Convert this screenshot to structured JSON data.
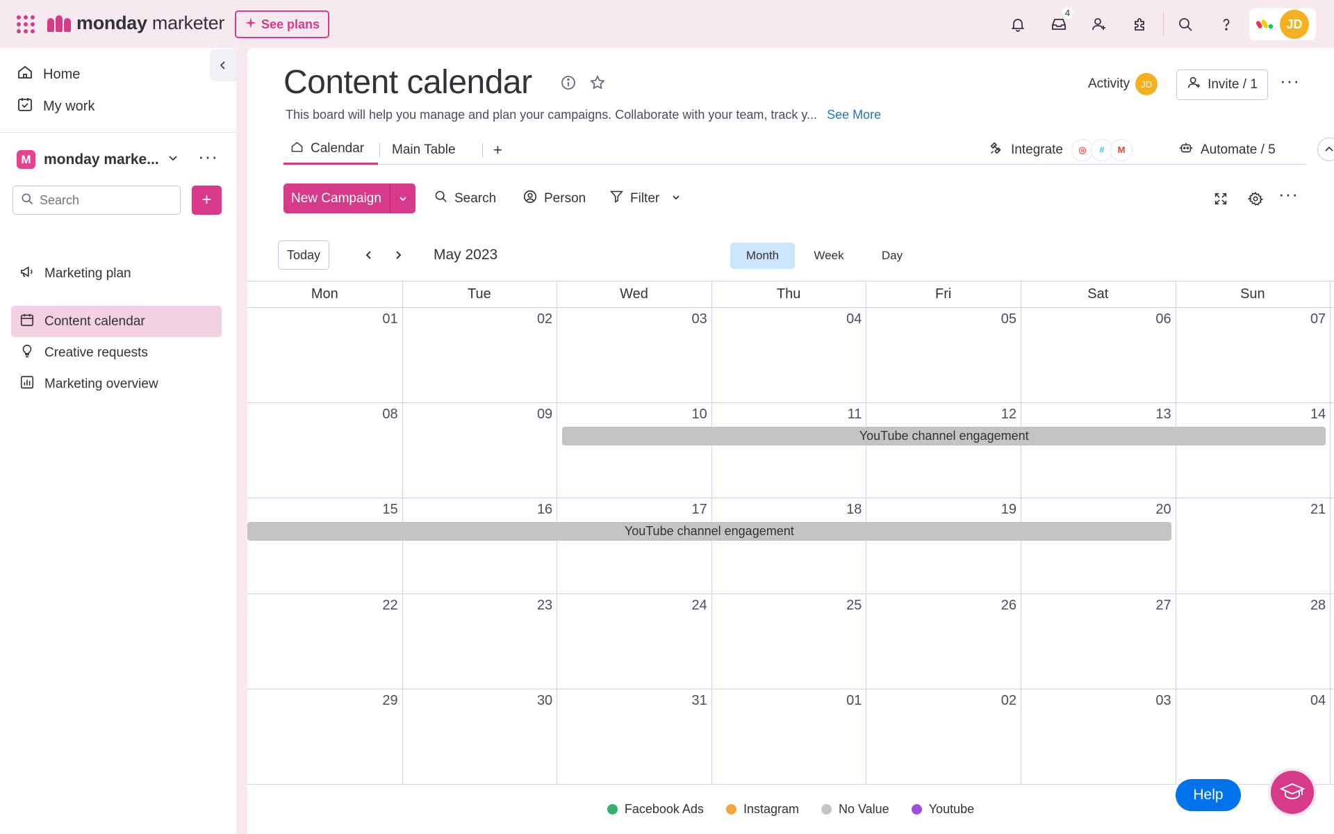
{
  "app": {
    "brand_bold": "monday",
    "brand_rest": " marketer",
    "see_plans": "See plans",
    "notifications_badge": "4",
    "avatar_initials": "JD"
  },
  "sidebar": {
    "home": "Home",
    "my_work": "My work",
    "workspace_badge": "M",
    "workspace_name": "monday marke...",
    "search_placeholder": "Search",
    "boards": [
      {
        "label": "Marketing plan",
        "icon": "megaphone-icon"
      },
      {
        "label": "Content calendar",
        "icon": "calendar-icon"
      },
      {
        "label": "Creative requests",
        "icon": "lightbulb-icon"
      },
      {
        "label": "Marketing overview",
        "icon": "dashboard-icon"
      }
    ]
  },
  "board": {
    "title": "Content calendar",
    "description": "This board will help you manage and plan your campaigns. Collaborate with your team, track y...",
    "see_more": "See More",
    "activity": "Activity",
    "activity_avatar": "JD",
    "invite": "Invite / 1"
  },
  "tabs": {
    "calendar": "Calendar",
    "main_table": "Main Table",
    "add": "+",
    "integrate": "Integrate",
    "automate": "Automate / 5"
  },
  "toolbar": {
    "new_campaign": "New Campaign",
    "search": "Search",
    "person": "Person",
    "filter": "Filter"
  },
  "calendar": {
    "today": "Today",
    "month_label": "May 2023",
    "views": [
      "Month",
      "Week",
      "Day"
    ],
    "active_view": "Month",
    "weekdays": [
      "Mon",
      "Tue",
      "Wed",
      "Thu",
      "Fri",
      "Sat",
      "Sun"
    ],
    "weeks": [
      [
        "01",
        "02",
        "03",
        "04",
        "05",
        "06",
        "07"
      ],
      [
        "08",
        "09",
        "10",
        "11",
        "12",
        "13",
        "14"
      ],
      [
        "15",
        "16",
        "17",
        "18",
        "19",
        "20",
        "21"
      ],
      [
        "22",
        "23",
        "24",
        "25",
        "26",
        "27",
        "28"
      ],
      [
        "29",
        "30",
        "31",
        "01",
        "02",
        "03",
        "04"
      ]
    ],
    "events": [
      {
        "label": "YouTube channel engagement",
        "start": "2023-05-10",
        "end": "2023-05-14"
      },
      {
        "label": "YouTube channel engagement",
        "start": "2023-05-15",
        "end": "2023-05-20"
      }
    ]
  },
  "legend": [
    {
      "label": "Facebook Ads",
      "color": "#33b06b"
    },
    {
      "label": "Instagram",
      "color": "#f2a93b"
    },
    {
      "label": "No Value",
      "color": "#c4c4c4"
    },
    {
      "label": "Youtube",
      "color": "#9d50dd"
    }
  ],
  "help": {
    "label": "Help"
  },
  "colors": {
    "accent": "#d83a8a",
    "primary": "#0073ea",
    "event": "#c4c4c4"
  }
}
